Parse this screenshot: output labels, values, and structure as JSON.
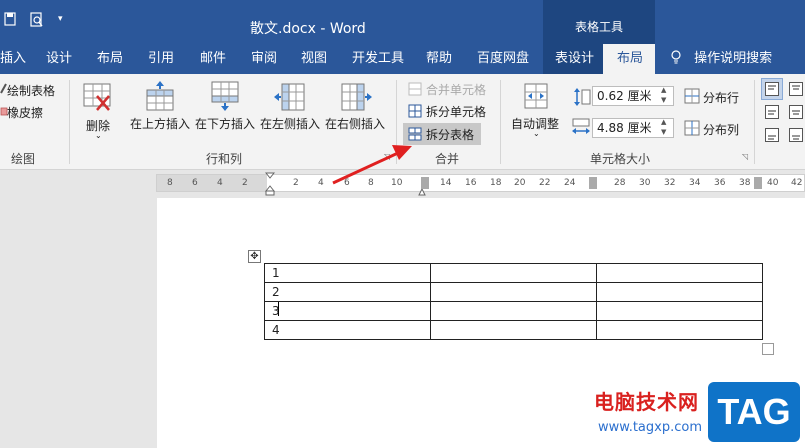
{
  "titlebar": {
    "doc_title": "散文.docx  -  Word",
    "contextual_group": "表格工具"
  },
  "tabs": [
    "插入",
    "设计",
    "布局",
    "引用",
    "邮件",
    "审阅",
    "视图",
    "开发工具",
    "帮助",
    "百度网盘",
    "表设计",
    "布局",
    "操作说明搜索"
  ],
  "ribbon": {
    "draw": {
      "draw_table": "绘制表格",
      "eraser": "橡皮擦",
      "group_label": "绘图"
    },
    "rows_cols": {
      "delete": "删除",
      "insert_above": "在上方插入",
      "insert_below": "在下方插入",
      "insert_left": "在左侧插入",
      "insert_right": "在右侧插入",
      "group_label": "行和列"
    },
    "merge": {
      "merge_cells": "合并单元格",
      "split_cells": "拆分单元格",
      "split_table": "拆分表格",
      "group_label": "合并"
    },
    "cell_size": {
      "autofit": "自动调整",
      "height_value": "0.62 厘米",
      "width_value": "4.88 厘米",
      "distribute_rows": "分布行",
      "distribute_cols": "分布列",
      "group_label": "单元格大小"
    }
  },
  "ruler": {
    "numbers": [
      "8",
      "6",
      "4",
      "2",
      "2",
      "4",
      "6",
      "8",
      "10",
      "14",
      "16",
      "18",
      "20",
      "22",
      "24",
      "28",
      "30",
      "32",
      "34",
      "36",
      "38",
      "40",
      "42"
    ]
  },
  "table": {
    "rows": [
      [
        "1",
        "",
        ""
      ],
      [
        "2",
        "",
        ""
      ],
      [
        "3",
        "",
        ""
      ],
      [
        "4",
        "",
        ""
      ]
    ]
  },
  "watermark": {
    "site_name": "电脑技术网",
    "url": "www.tagxp.com",
    "badge": "TAG"
  },
  "colors": {
    "titlebar": "#2b579a",
    "contextual": "#1e4680",
    "arrow": "#e02020"
  },
  "icons": [
    "save-icon",
    "print-preview-icon",
    "customize-qat-icon",
    "lightbulb-icon",
    "pencil-icon",
    "eraser-icon",
    "table-delete-icon",
    "insert-above-icon",
    "insert-below-icon",
    "insert-left-icon",
    "insert-right-icon",
    "merge-cells-icon",
    "split-cells-icon",
    "split-table-icon",
    "autofit-icon",
    "height-icon",
    "width-icon",
    "distribute-rows-icon",
    "distribute-cols-icon",
    "align-icon",
    "table-move-icon"
  ]
}
